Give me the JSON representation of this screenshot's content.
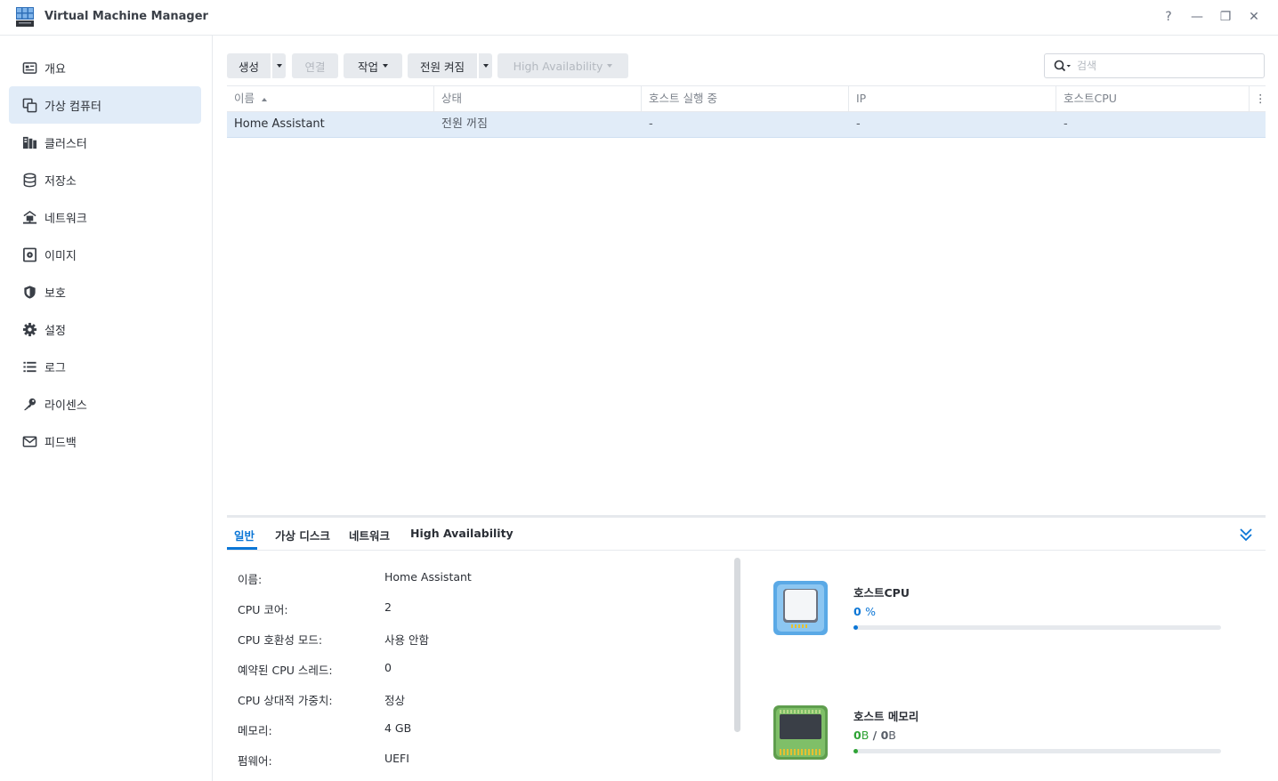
{
  "window": {
    "title": "Virtual Machine Manager",
    "controls": [
      "?",
      "—",
      "❐",
      "✕"
    ]
  },
  "sidebar": {
    "items": [
      {
        "label": "개요",
        "icon": "overview-icon"
      },
      {
        "label": "가상 컴퓨터",
        "icon": "virtual-machine-icon",
        "active": true
      },
      {
        "label": "클러스터",
        "icon": "cluster-icon"
      },
      {
        "label": "저장소",
        "icon": "storage-icon"
      },
      {
        "label": "네트워크",
        "icon": "network-icon"
      },
      {
        "label": "이미지",
        "icon": "image-icon"
      },
      {
        "label": "보호",
        "icon": "shield-icon"
      },
      {
        "label": "설정",
        "icon": "gear-icon"
      },
      {
        "label": "로그",
        "icon": "log-list-icon"
      },
      {
        "label": "라이센스",
        "icon": "key-icon"
      },
      {
        "label": "피드백",
        "icon": "mail-icon"
      }
    ]
  },
  "toolbar": {
    "create": "생성",
    "connect": "연결",
    "action": "작업",
    "power_off": "전원 켜짐",
    "high_availability": "High Availability",
    "search_placeholder": "검색"
  },
  "grid": {
    "columns": [
      "이름",
      "상태",
      "호스트 실행 중",
      "IP",
      "호스트CPU"
    ],
    "rows": [
      {
        "name": "Home Assistant",
        "status": "전원 꺼짐",
        "host": "-",
        "ip": "-",
        "cpu": "-"
      }
    ]
  },
  "details": {
    "tabs": [
      "일반",
      "가상 디스크",
      "네트워크",
      "High Availability"
    ],
    "properties": [
      {
        "label": "이름:",
        "value": "Home Assistant"
      },
      {
        "label": "CPU 코어:",
        "value": "2"
      },
      {
        "label": "CPU 호환성 모드:",
        "value": "사용 안함"
      },
      {
        "label": "예약된 CPU 스레드:",
        "value": "0"
      },
      {
        "label": "CPU 상대적 가중치:",
        "value": "정상"
      },
      {
        "label": "메모리:",
        "value": "4 GB"
      },
      {
        "label": "펌웨어:",
        "value": "UEFI"
      }
    ],
    "resources": {
      "cpu": {
        "title": "호스트CPU",
        "value_num": "0",
        "value_unit": "%",
        "fraction": 0.0,
        "color": "#0b76d6"
      },
      "memory": {
        "title": "호스트 메모리",
        "used_num": "0",
        "used_unit": "B",
        "sep": "/",
        "total_num": "0",
        "total_unit": "B",
        "fraction": 0.0,
        "color": "#2fa335"
      }
    }
  },
  "colors": {
    "accent": "#0b76d6",
    "selection": "#e1ecf8",
    "button": "#e7eaee",
    "memory_green": "#2fa335"
  }
}
